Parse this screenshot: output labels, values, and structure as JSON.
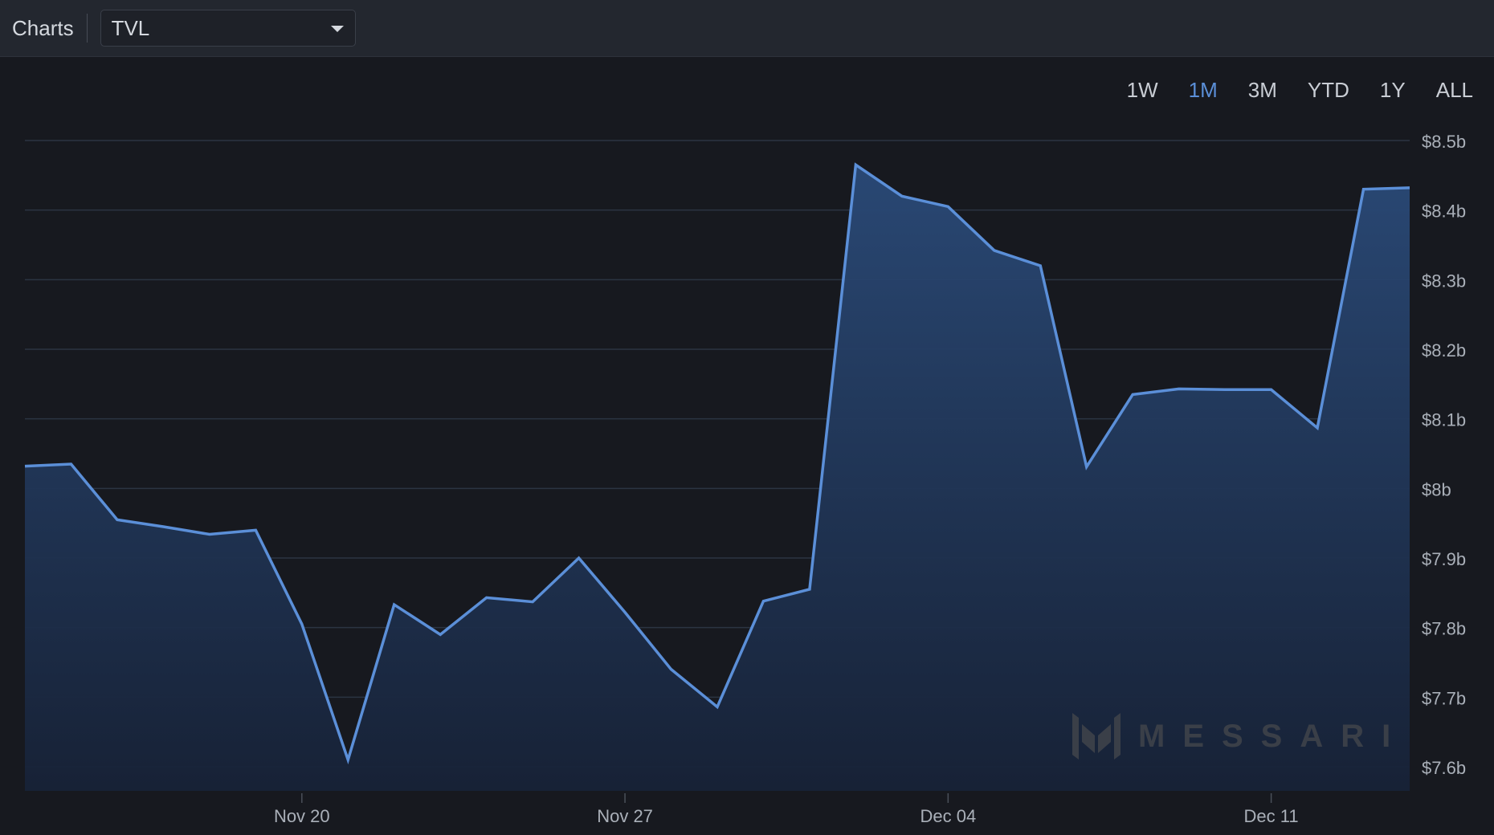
{
  "header": {
    "title": "Charts",
    "selected_metric": "TVL"
  },
  "time_ranges": [
    {
      "label": "1W",
      "active": false
    },
    {
      "label": "1M",
      "active": true
    },
    {
      "label": "3M",
      "active": false
    },
    {
      "label": "YTD",
      "active": false
    },
    {
      "label": "1Y",
      "active": false
    },
    {
      "label": "ALL",
      "active": false
    }
  ],
  "watermark": "MESSARI",
  "colors": {
    "background": "#17191f",
    "line": "#5b8fd8",
    "area_top": "#2a4a78",
    "area_bottom": "#172237",
    "grid": "#2b3442",
    "active_range": "#5b8fd8"
  },
  "chart_data": {
    "type": "area",
    "grid": true,
    "y_axis_position": "right",
    "ylim": [
      7.6,
      8.5
    ],
    "y_ticks": [
      {
        "value": 8.5,
        "label": "$8.5b"
      },
      {
        "value": 8.4,
        "label": "$8.4b"
      },
      {
        "value": 8.3,
        "label": "$8.3b"
      },
      {
        "value": 8.2,
        "label": "$8.2b"
      },
      {
        "value": 8.1,
        "label": "$8.1b"
      },
      {
        "value": 8.0,
        "label": "$8b"
      },
      {
        "value": 7.9,
        "label": "$7.9b"
      },
      {
        "value": 7.8,
        "label": "$7.8b"
      },
      {
        "value": 7.7,
        "label": "$7.7b"
      },
      {
        "value": 7.6,
        "label": "$7.6b"
      }
    ],
    "x_ticks": [
      {
        "date": "Nov 20",
        "label": "Nov 20"
      },
      {
        "date": "Nov 27",
        "label": "Nov 27"
      },
      {
        "date": "Dec 04",
        "label": "Dec 04"
      },
      {
        "date": "Dec 11",
        "label": "Dec 11"
      }
    ],
    "series": [
      {
        "points": [
          {
            "x": "Nov 14",
            "y": 8.032
          },
          {
            "x": "Nov 15",
            "y": 8.035
          },
          {
            "x": "Nov 16",
            "y": 7.955
          },
          {
            "x": "Nov 17",
            "y": 7.945
          },
          {
            "x": "Nov 18",
            "y": 7.934
          },
          {
            "x": "Nov 19",
            "y": 7.94
          },
          {
            "x": "Nov 20",
            "y": 7.805
          },
          {
            "x": "Nov 21",
            "y": 7.61
          },
          {
            "x": "Nov 22",
            "y": 7.833
          },
          {
            "x": "Nov 23",
            "y": 7.79
          },
          {
            "x": "Nov 24",
            "y": 7.843
          },
          {
            "x": "Nov 25",
            "y": 7.837
          },
          {
            "x": "Nov 26",
            "y": 7.9
          },
          {
            "x": "Nov 27",
            "y": 7.822
          },
          {
            "x": "Nov 28",
            "y": 7.74
          },
          {
            "x": "Nov 29",
            "y": 7.686
          },
          {
            "x": "Nov 30",
            "y": 7.838
          },
          {
            "x": "Dec 01",
            "y": 7.855
          },
          {
            "x": "Dec 02",
            "y": 8.465
          },
          {
            "x": "Dec 03",
            "y": 8.42
          },
          {
            "x": "Dec 04",
            "y": 8.405
          },
          {
            "x": "Dec 05",
            "y": 8.342
          },
          {
            "x": "Dec 06",
            "y": 8.32
          },
          {
            "x": "Dec 07",
            "y": 8.031
          },
          {
            "x": "Dec 08",
            "y": 8.135
          },
          {
            "x": "Dec 09",
            "y": 8.143
          },
          {
            "x": "Dec 10",
            "y": 8.142
          },
          {
            "x": "Dec 11",
            "y": 8.142
          },
          {
            "x": "Dec 12",
            "y": 8.087
          },
          {
            "x": "Dec 13",
            "y": 8.43
          },
          {
            "x": "Dec 14",
            "y": 8.432
          }
        ]
      }
    ]
  }
}
